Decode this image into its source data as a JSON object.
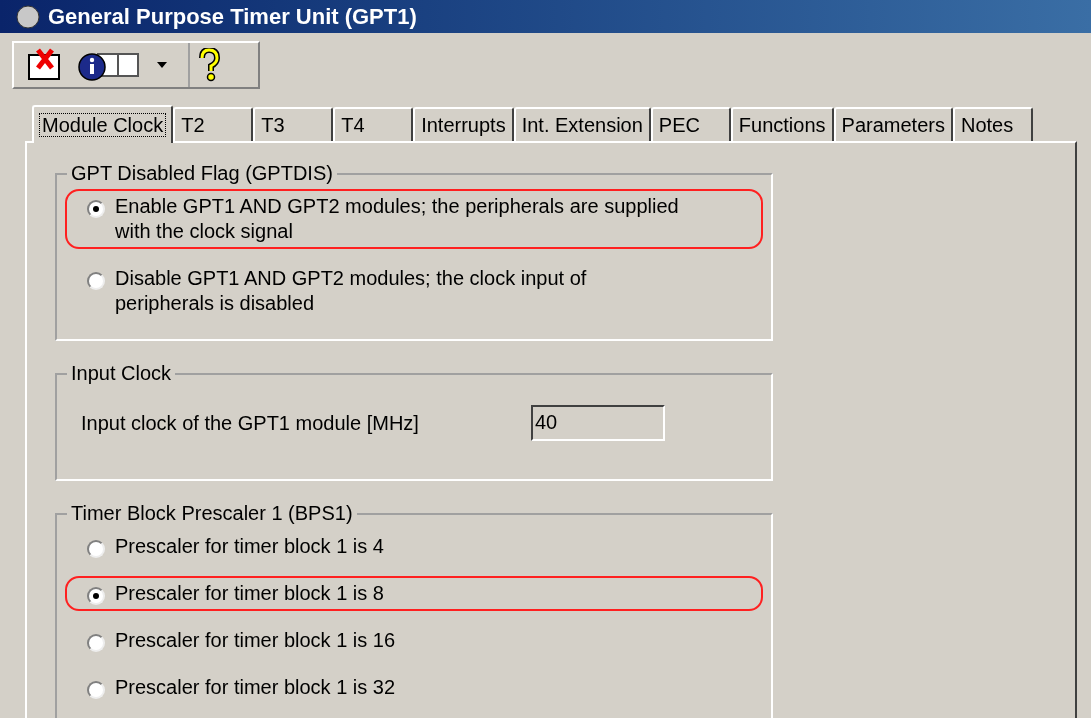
{
  "window": {
    "title": "General Purpose Timer Unit (GPT1)"
  },
  "toolbar": {
    "buttons": [
      {
        "kind": "close"
      },
      {
        "kind": "info"
      },
      {
        "kind": "dropdown"
      },
      {
        "kind": "help"
      }
    ]
  },
  "tabs": [
    {
      "label": "Module Clock",
      "selected": true
    },
    {
      "label": "T2",
      "selected": false
    },
    {
      "label": "T3",
      "selected": false
    },
    {
      "label": "T4",
      "selected": false
    },
    {
      "label": "Interrupts",
      "selected": false
    },
    {
      "label": "Int. Extension",
      "selected": false
    },
    {
      "label": "PEC",
      "selected": false
    },
    {
      "label": "Functions",
      "selected": false
    },
    {
      "label": "Parameters",
      "selected": false
    },
    {
      "label": "Notes",
      "selected": false
    }
  ],
  "groups": [
    {
      "kind": "radio",
      "title": "GPT Disabled Flag (GPTDIS)",
      "options": [
        {
          "label": "Enable GPT1 AND GPT2 modules; the peripherals are supplied with the clock signal",
          "selected": true,
          "highlighted": true
        },
        {
          "label": "Disable GPT1 AND GPT2 modules; the clock input of peripherals is disabled",
          "selected": false,
          "highlighted": false
        }
      ]
    },
    {
      "kind": "field",
      "title": "Input Clock",
      "label": "Input clock of the GPT1 module [MHz]",
      "value": "40"
    },
    {
      "kind": "radio",
      "title": "Timer Block Prescaler 1 (BPS1)",
      "options": [
        {
          "label": "Prescaler for timer block 1 is 4",
          "selected": false,
          "highlighted": false
        },
        {
          "label": "Prescaler for timer block 1 is 8",
          "selected": true,
          "highlighted": true
        },
        {
          "label": "Prescaler for timer block 1 is 16",
          "selected": false,
          "highlighted": false
        },
        {
          "label": "Prescaler for timer block 1 is 32",
          "selected": false,
          "highlighted": false
        }
      ]
    }
  ]
}
